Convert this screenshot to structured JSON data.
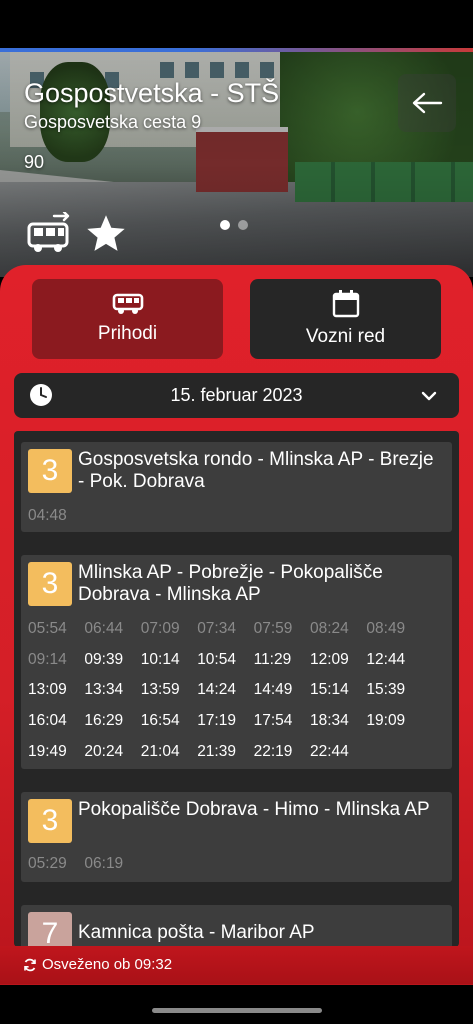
{
  "stop": {
    "name": "Gospostvetska - STŠ",
    "address": "Gosposvetska cesta 9",
    "code": "90"
  },
  "hero_icons": [
    "bus-realtime-icon",
    "star-icon",
    "back-arrow-icon"
  ],
  "carousel": {
    "pages": 2,
    "active": 1
  },
  "tabs": {
    "arrivals": {
      "label": "Prihodi",
      "icon": "bus-icon"
    },
    "timetable": {
      "label": "Vozni red",
      "icon": "calendar-icon"
    }
  },
  "date_bar": {
    "date": "15. februar 2023"
  },
  "colors": {
    "primary_red": "#e0212a",
    "line3": "#f3bd5e",
    "line7": "#c9a39c",
    "dark_card": "#3d3d3d"
  },
  "routes": [
    {
      "line": "3",
      "name": "Gosposvetska rondo - Mlinska AP - Brezje - Pok. Dobrava",
      "times": [
        {
          "t": "04:48",
          "past": true
        }
      ]
    },
    {
      "line": "3",
      "name": "Mlinska AP - Pobrežje - Pokopališče Dobrava - Mlinska AP",
      "times": [
        {
          "t": "05:54",
          "past": true
        },
        {
          "t": "06:44",
          "past": true
        },
        {
          "t": "07:09",
          "past": true
        },
        {
          "t": "07:34",
          "past": true
        },
        {
          "t": "07:59",
          "past": true
        },
        {
          "t": "08:24",
          "past": true
        },
        {
          "t": "08:49",
          "past": true
        },
        {
          "t": "09:14",
          "past": true
        },
        {
          "t": "09:39",
          "past": false
        },
        {
          "t": "10:14",
          "past": false
        },
        {
          "t": "10:54",
          "past": false
        },
        {
          "t": "11:29",
          "past": false
        },
        {
          "t": "12:09",
          "past": false
        },
        {
          "t": "12:44",
          "past": false
        },
        {
          "t": "13:09",
          "past": false
        },
        {
          "t": "13:34",
          "past": false
        },
        {
          "t": "13:59",
          "past": false
        },
        {
          "t": "14:24",
          "past": false
        },
        {
          "t": "14:49",
          "past": false
        },
        {
          "t": "15:14",
          "past": false
        },
        {
          "t": "15:39",
          "past": false
        },
        {
          "t": "16:04",
          "past": false
        },
        {
          "t": "16:29",
          "past": false
        },
        {
          "t": "16:54",
          "past": false
        },
        {
          "t": "17:19",
          "past": false
        },
        {
          "t": "17:54",
          "past": false
        },
        {
          "t": "18:34",
          "past": false
        },
        {
          "t": "19:09",
          "past": false
        },
        {
          "t": "19:49",
          "past": false
        },
        {
          "t": "20:24",
          "past": false
        },
        {
          "t": "21:04",
          "past": false
        },
        {
          "t": "21:39",
          "past": false
        },
        {
          "t": "22:19",
          "past": false
        },
        {
          "t": "22:44",
          "past": false
        }
      ]
    },
    {
      "line": "3",
      "name": "Pokopališče Dobrava - Himo - Mlinska AP",
      "times": [
        {
          "t": "05:29",
          "past": true
        },
        {
          "t": "06:19",
          "past": true
        }
      ]
    },
    {
      "line": "7",
      "name": "Kamnica pošta - Maribor AP",
      "times": []
    }
  ],
  "footer": {
    "refreshed": "Osveženo ob 09:32"
  }
}
